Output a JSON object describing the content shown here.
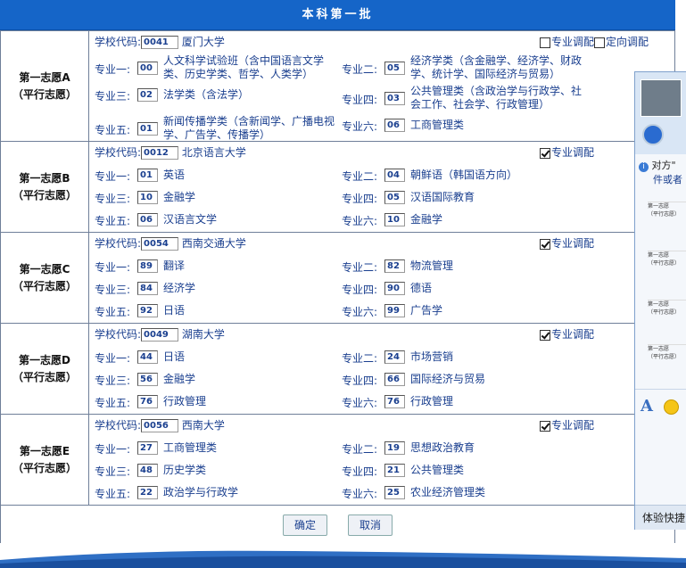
{
  "header": {
    "title": "本科第一批"
  },
  "labels": {
    "school_code": "学校代码:",
    "adjust": "专业调配",
    "directional": "定向调配"
  },
  "choices": [
    {
      "title": "第一志愿A",
      "subtitle": "（平行志愿）",
      "code": "0041",
      "school": "厦门大学",
      "adjust_checked": false,
      "show_directional": true,
      "directional_checked": false,
      "majors": [
        {
          "label": "专业一:",
          "code": "00",
          "name": "人文科学试验班（含中国语言文学类、历史学类、哲学、人类学）"
        },
        {
          "label": "专业二:",
          "code": "05",
          "name": "经济学类（含金融学、经济学、财政学、统计学、国际经济与贸易）"
        },
        {
          "label": "专业三:",
          "code": "02",
          "name": "法学类（含法学）"
        },
        {
          "label": "专业四:",
          "code": "03",
          "name": "公共管理类（含政治学与行政学、社会工作、社会学、行政管理）"
        },
        {
          "label": "专业五:",
          "code": "01",
          "name": "新闻传播学类（含新闻学、广播电视学、广告学、传播学）"
        },
        {
          "label": "专业六:",
          "code": "06",
          "name": "工商管理类"
        }
      ]
    },
    {
      "title": "第一志愿B",
      "subtitle": "（平行志愿）",
      "code": "0012",
      "school": "北京语言大学",
      "adjust_checked": true,
      "show_directional": false,
      "majors": [
        {
          "label": "专业一:",
          "code": "01",
          "name": "英语"
        },
        {
          "label": "专业二:",
          "code": "04",
          "name": "朝鲜语（韩国语方向）"
        },
        {
          "label": "专业三:",
          "code": "10",
          "name": "金融学"
        },
        {
          "label": "专业四:",
          "code": "05",
          "name": "汉语国际教育"
        },
        {
          "label": "专业五:",
          "code": "06",
          "name": "汉语言文学"
        },
        {
          "label": "专业六:",
          "code": "10",
          "name": "金融学"
        }
      ]
    },
    {
      "title": "第一志愿C",
      "subtitle": "（平行志愿）",
      "code": "0054",
      "school": "西南交通大学",
      "adjust_checked": true,
      "show_directional": false,
      "majors": [
        {
          "label": "专业一:",
          "code": "89",
          "name": "翻译"
        },
        {
          "label": "专业二:",
          "code": "82",
          "name": "物流管理"
        },
        {
          "label": "专业三:",
          "code": "84",
          "name": "经济学"
        },
        {
          "label": "专业四:",
          "code": "90",
          "name": "德语"
        },
        {
          "label": "专业五:",
          "code": "92",
          "name": "日语"
        },
        {
          "label": "专业六:",
          "code": "99",
          "name": "广告学"
        }
      ]
    },
    {
      "title": "第一志愿D",
      "subtitle": "（平行志愿）",
      "code": "0049",
      "school": "湖南大学",
      "adjust_checked": true,
      "show_directional": false,
      "majors": [
        {
          "label": "专业一:",
          "code": "44",
          "name": "日语"
        },
        {
          "label": "专业二:",
          "code": "24",
          "name": "市场营销"
        },
        {
          "label": "专业三:",
          "code": "56",
          "name": "金融学"
        },
        {
          "label": "专业四:",
          "code": "66",
          "name": "国际经济与贸易"
        },
        {
          "label": "专业五:",
          "code": "76",
          "name": "行政管理"
        },
        {
          "label": "专业六:",
          "code": "76",
          "name": "行政管理"
        }
      ]
    },
    {
      "title": "第一志愿E",
      "subtitle": "（平行志愿）",
      "code": "0056",
      "school": "西南大学",
      "adjust_checked": true,
      "show_directional": false,
      "majors": [
        {
          "label": "专业一:",
          "code": "27",
          "name": "工商管理类"
        },
        {
          "label": "专业二:",
          "code": "19",
          "name": "思想政治教育"
        },
        {
          "label": "专业三:",
          "code": "48",
          "name": "历史学类"
        },
        {
          "label": "专业四:",
          "code": "21",
          "name": "公共管理类"
        },
        {
          "label": "专业五:",
          "code": "22",
          "name": "政治学与行政学"
        },
        {
          "label": "专业六:",
          "code": "25",
          "name": "农业经济管理类"
        }
      ]
    }
  ],
  "buttons": {
    "confirm": "确定",
    "cancel": "取消"
  },
  "side_panel": {
    "info_line1": "对方\"",
    "info_line2": "件或者",
    "bottom_label": "体验快捷",
    "thumb_title": "第一志愿",
    "thumb_sub": "（平行志愿）"
  }
}
